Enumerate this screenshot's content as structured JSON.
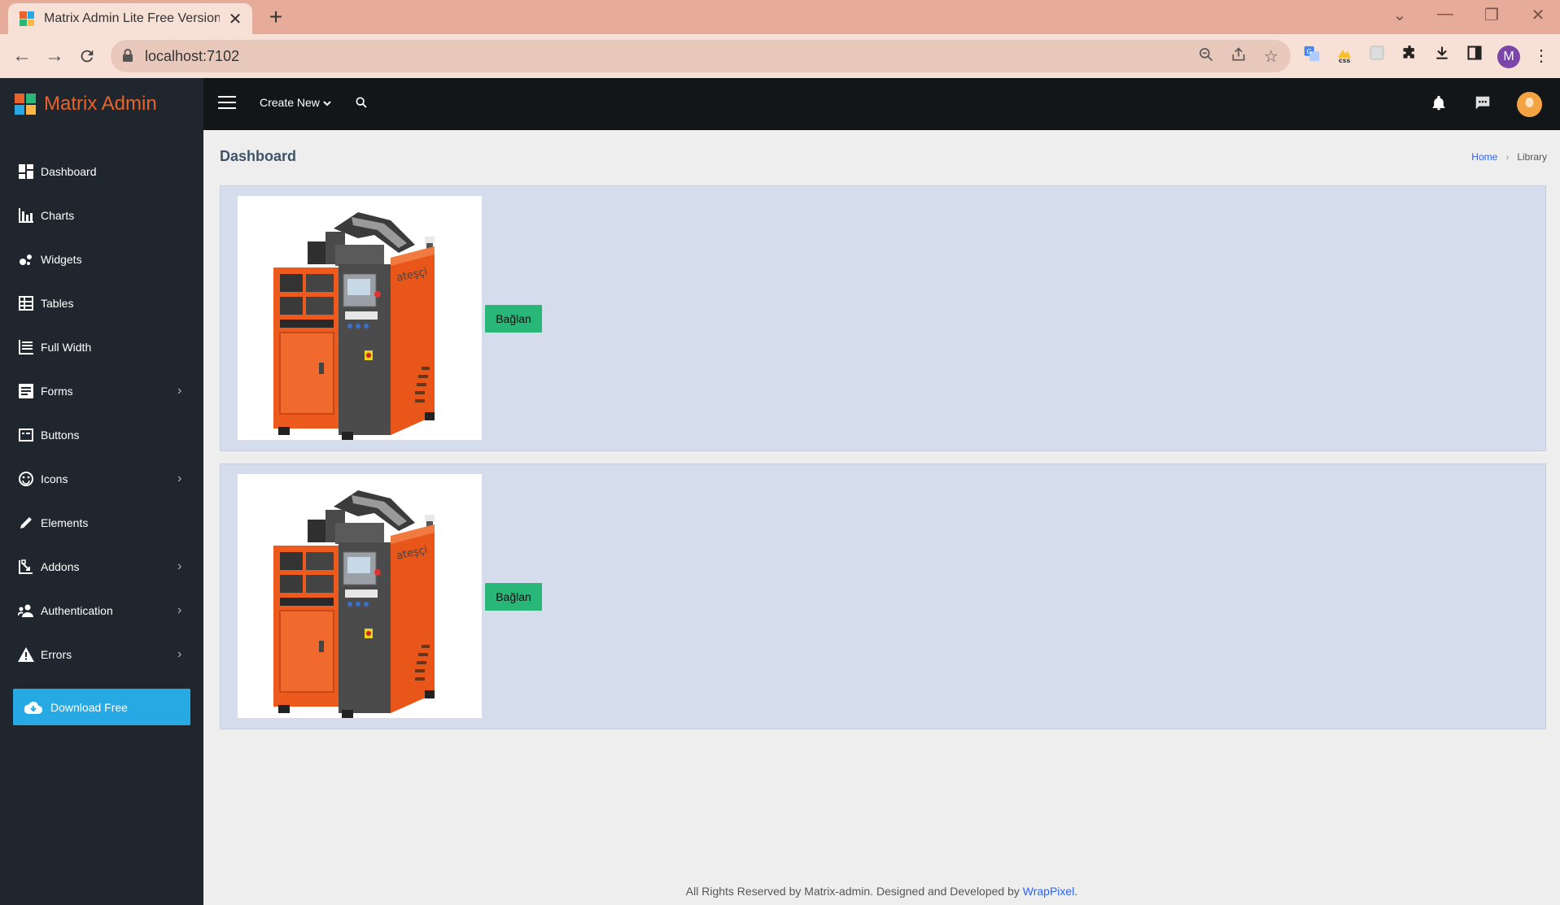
{
  "browser": {
    "tab_title": "Matrix Admin Lite Free Versions",
    "url": "localhost:7102",
    "profile_initial": "M"
  },
  "app": {
    "brand": "Matrix Admin",
    "create_new": "Create New"
  },
  "sidebar": {
    "items": [
      {
        "label": "Dashboard",
        "icon": "dashboard-icon",
        "has_arrow": false
      },
      {
        "label": "Charts",
        "icon": "bar-chart-icon",
        "has_arrow": false
      },
      {
        "label": "Widgets",
        "icon": "widgets-icon",
        "has_arrow": false
      },
      {
        "label": "Tables",
        "icon": "table-icon",
        "has_arrow": false
      },
      {
        "label": "Full Width",
        "icon": "full-width-icon",
        "has_arrow": false
      },
      {
        "label": "Forms",
        "icon": "forms-icon",
        "has_arrow": true
      },
      {
        "label": "Buttons",
        "icon": "buttons-icon",
        "has_arrow": false
      },
      {
        "label": "Icons",
        "icon": "face-icon",
        "has_arrow": true
      },
      {
        "label": "Elements",
        "icon": "pencil-icon",
        "has_arrow": false
      },
      {
        "label": "Addons",
        "icon": "addons-icon",
        "has_arrow": true
      },
      {
        "label": "Authentication",
        "icon": "users-icon",
        "has_arrow": true
      },
      {
        "label": "Errors",
        "icon": "warning-icon",
        "has_arrow": true
      }
    ],
    "download_label": "Download Free"
  },
  "page": {
    "title": "Dashboard",
    "breadcrumb": [
      "Home",
      "Library"
    ]
  },
  "cards": [
    {
      "button_label": "Bağlan",
      "image_text": "ateşçi"
    },
    {
      "button_label": "Bağlan",
      "image_text": "ateşçi"
    }
  ],
  "footer": {
    "text": "All Rights Reserved by Matrix-admin. Designed and Developed by ",
    "link": "WrapPixel",
    "end": "."
  },
  "colors": {
    "brand": "#e8632b",
    "sidebar_bg": "#1f262d",
    "topbar_bg": "#131618",
    "download_btn": "#27a9e3",
    "card_bg": "#d5dded",
    "connect_btn": "#28b779"
  }
}
